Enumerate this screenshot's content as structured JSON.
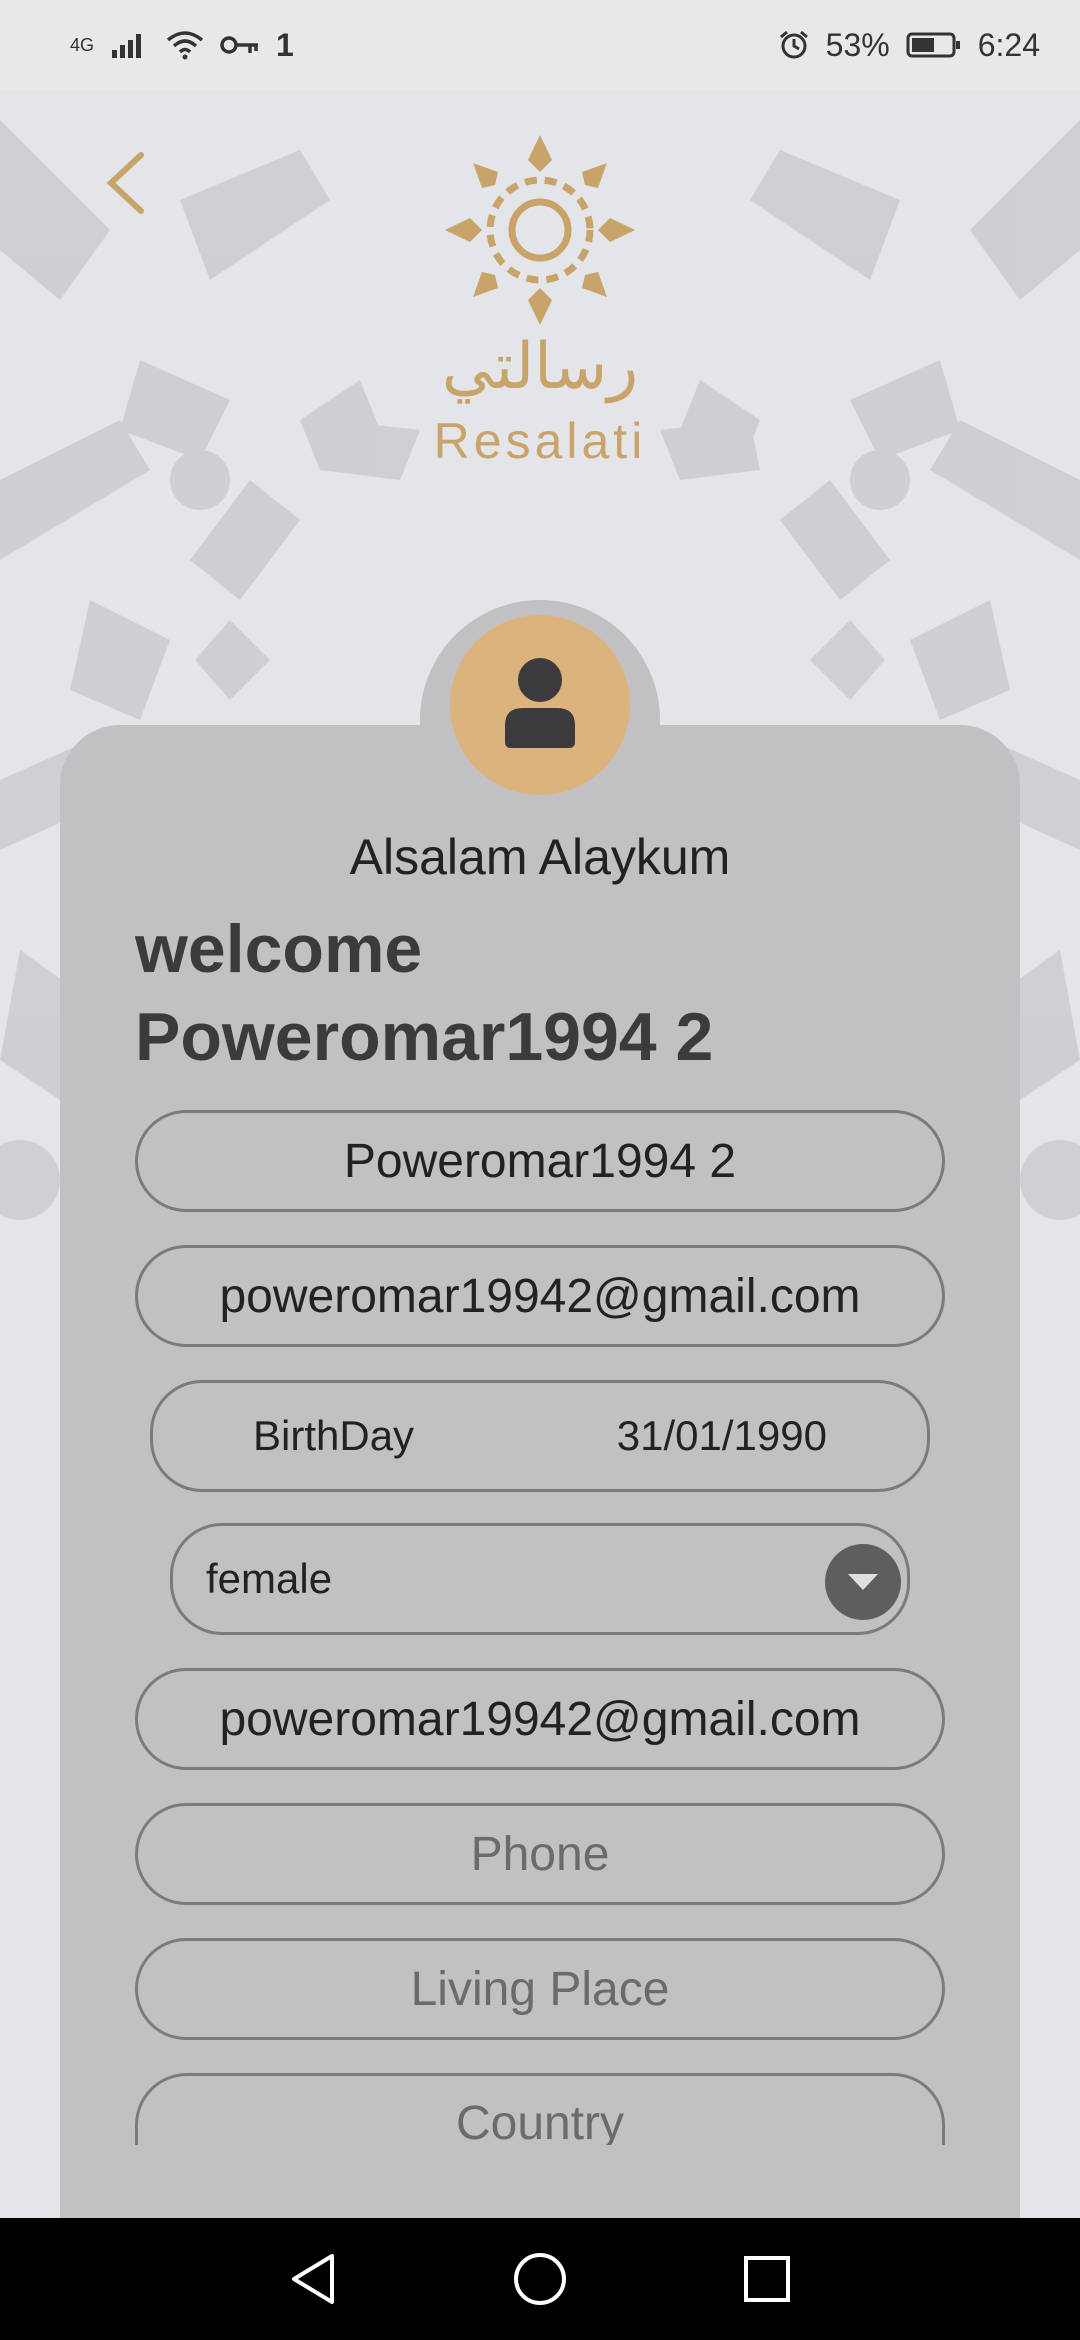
{
  "status_bar": {
    "network": "4G",
    "sim_indicator": "1",
    "battery": "53%",
    "time": "6:24",
    "icons": [
      "signal-icon",
      "wifi-icon",
      "key-icon",
      "alarm-icon",
      "battery-icon"
    ]
  },
  "header": {
    "back_icon": "chevron-left-icon",
    "logo_arabic": "رسالتي",
    "logo_latin": "Resalati"
  },
  "profile": {
    "avatar_icon": "person-icon",
    "greeting": "Alsalam Alaykum",
    "welcome_line1": "welcome",
    "welcome_line2": "Poweromar1994 2"
  },
  "form": {
    "username": "Poweromar1994 2",
    "email": "poweromar19942@gmail.com",
    "birthday_label": "BirthDay",
    "birthday_value": "31/01/1990",
    "gender_value": "female",
    "email_secondary": "poweromar19942@gmail.com",
    "phone_placeholder": "Phone",
    "living_place_placeholder": "Living Place",
    "country_placeholder": "Country"
  },
  "colors": {
    "accent_gold": "#c9a46a",
    "avatar_bg": "#dcb27d",
    "card_bg": "#c1c1c4"
  }
}
